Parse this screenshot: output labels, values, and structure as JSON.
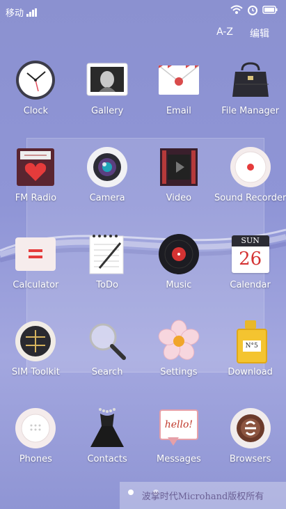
{
  "status_bar": {
    "carrier": "移动"
  },
  "top_bar": {
    "az_label": "A-Z",
    "edit_label": "编辑"
  },
  "apps": [
    {
      "label": "Clock",
      "icon": "clock-icon"
    },
    {
      "label": "Gallery",
      "icon": "gallery-icon"
    },
    {
      "label": "Email",
      "icon": "email-icon"
    },
    {
      "label": "File Manager",
      "icon": "file-manager-icon"
    },
    {
      "label": "FM Radio",
      "icon": "radio-icon"
    },
    {
      "label": "Camera",
      "icon": "camera-icon"
    },
    {
      "label": "Video",
      "icon": "video-icon"
    },
    {
      "label": "Sound Recorder",
      "icon": "recorder-icon"
    },
    {
      "label": "Calculator",
      "icon": "calculator-icon"
    },
    {
      "label": "ToDo",
      "icon": "todo-icon"
    },
    {
      "label": "Music",
      "icon": "music-icon"
    },
    {
      "label": "Calendar",
      "icon": "calendar-icon"
    },
    {
      "label": "SIM Toolkit",
      "icon": "sim-icon"
    },
    {
      "label": "Search",
      "icon": "search-icon"
    },
    {
      "label": "Settings",
      "icon": "settings-icon"
    },
    {
      "label": "Download",
      "icon": "download-icon"
    },
    {
      "label": "Phones",
      "icon": "phone-icon"
    },
    {
      "label": "Contacts",
      "icon": "contacts-icon"
    },
    {
      "label": "Messages",
      "icon": "messages-icon"
    },
    {
      "label": "Browsers",
      "icon": "browser-icon"
    }
  ],
  "calendar": {
    "month": "SUN",
    "day": "26"
  },
  "perfume_text": "N°5",
  "message_text": "hello!",
  "page_dots": {
    "count": 2,
    "active": 0
  },
  "watermark": "波掌时代Microhand版权所有"
}
